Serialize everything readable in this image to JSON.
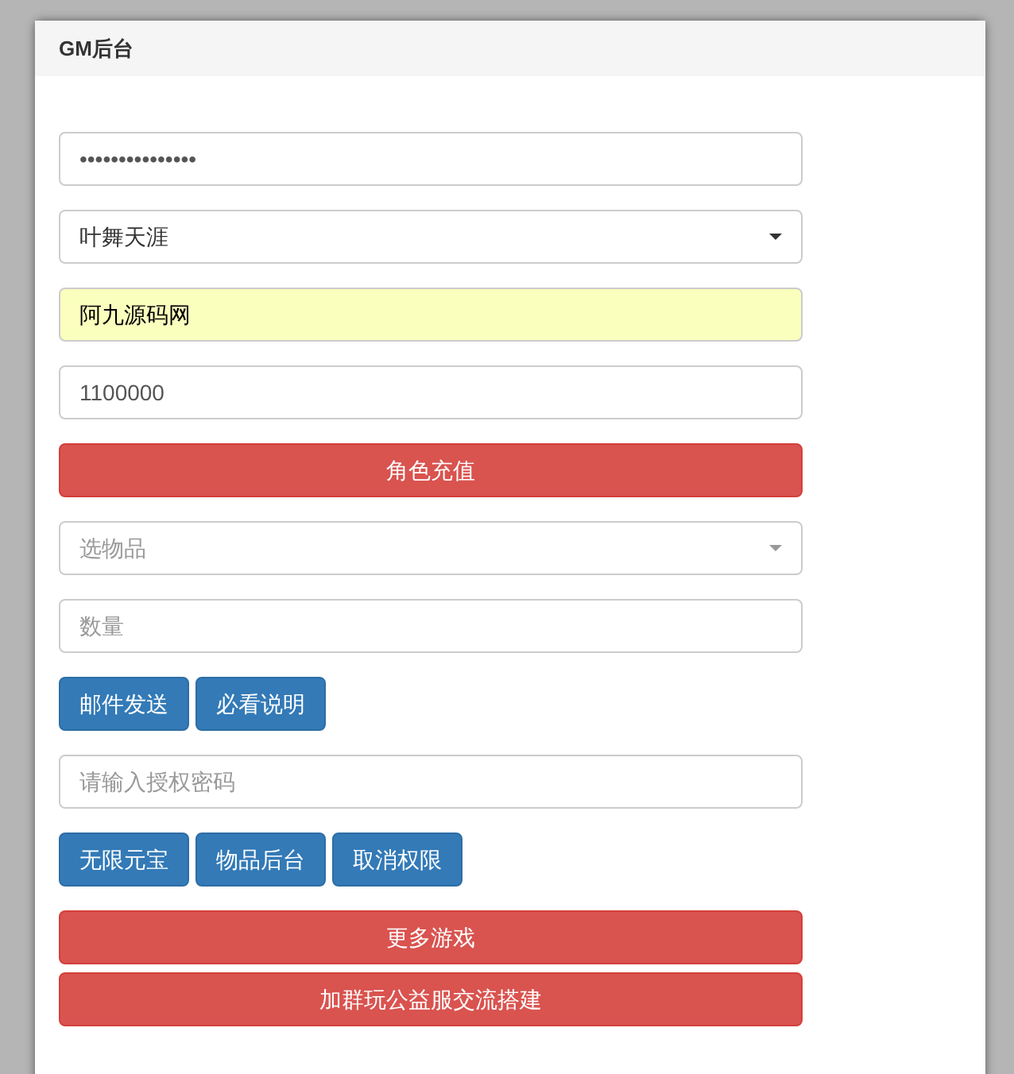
{
  "panel": {
    "title": "GM后台"
  },
  "controls": [
    {
      "kind": "input",
      "value": "•••••••••••••••",
      "autofilled": false
    },
    {
      "kind": "select",
      "value": "叶舞天涯"
    },
    {
      "kind": "input",
      "value": "阿九源码网",
      "autofilled": true
    },
    {
      "kind": "input",
      "value": "1100000",
      "autofilled": false
    },
    {
      "kind": "wide-button",
      "label": "角色充值"
    },
    {
      "kind": "select",
      "placeholder": "选物品"
    },
    {
      "kind": "input",
      "placeholder": "数量",
      "autofilled": false
    },
    {
      "kind": "buttons",
      "labels": [
        "邮件发送",
        "必看说明"
      ]
    },
    {
      "kind": "input",
      "placeholder": "请输入授权密码",
      "autofilled": false
    },
    {
      "kind": "buttons",
      "labels": [
        "无限元宝",
        "物品后台",
        "取消权限"
      ]
    },
    {
      "kind": "wide-button",
      "label": "更多游戏"
    },
    {
      "kind": "wide-button",
      "label": "加群玩公益服交流搭建"
    }
  ]
}
